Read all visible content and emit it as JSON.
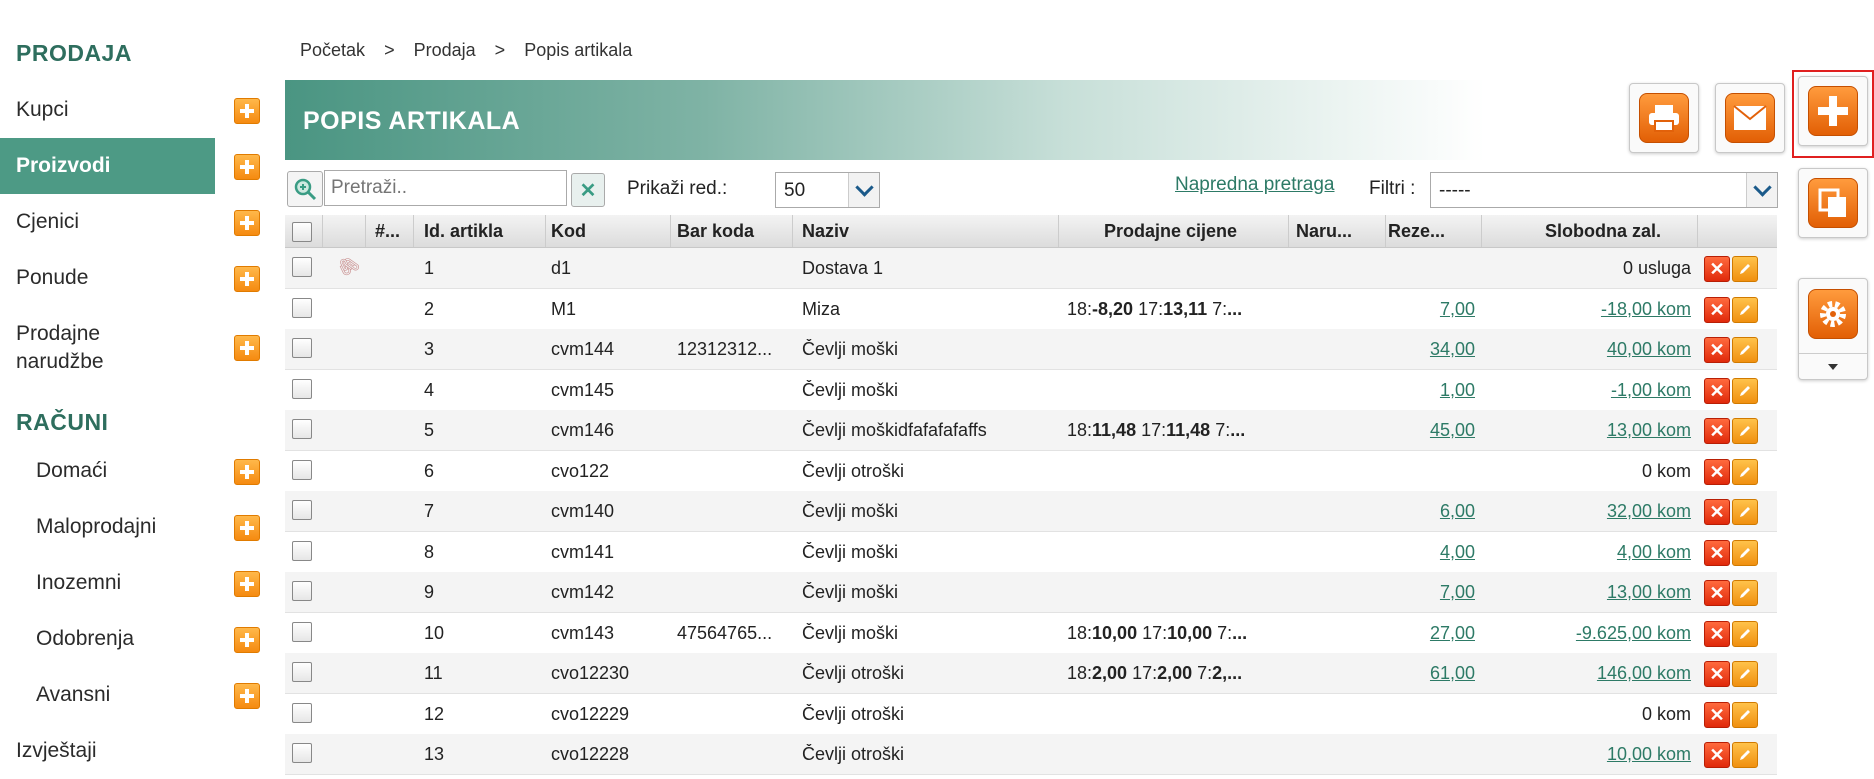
{
  "sidebar": {
    "section_sales": "PRODAJA",
    "items": [
      {
        "label": "Kupci"
      },
      {
        "label": "Proizvodi"
      },
      {
        "label": "Cjenici"
      },
      {
        "label": "Ponude"
      },
      {
        "label": "Prodajne narudžbe"
      }
    ],
    "section_invoices": "RAČUNI",
    "invoice_items": [
      {
        "label": "Domaći"
      },
      {
        "label": "Maloprodajni"
      },
      {
        "label": "Inozemni"
      },
      {
        "label": "Odobrenja"
      },
      {
        "label": "Avansni"
      }
    ],
    "reports": "Izvještaji"
  },
  "breadcrumb": {
    "home": "Početak",
    "sales": "Prodaja",
    "current": "Popis artikala",
    "separator": ">"
  },
  "page_title": "POPIS ARTIKALA",
  "toolbar": {
    "search_placeholder": "Pretraži..",
    "show_rows_label": "Prikaži red.:",
    "rows_value": "50",
    "advanced_search": "Napredna pretraga",
    "filters_label": "Filtri :",
    "filter_value": "-----"
  },
  "table": {
    "headers": {
      "num": "#...",
      "id": "Id. artikla",
      "code": "Kod",
      "barcode": "Bar koda",
      "name": "Naziv",
      "prices": "Prodajne cijene",
      "ordered": "Naru...",
      "reserved": "Reze...",
      "stock": "Slobodna zal."
    },
    "rows": [
      {
        "id": "1",
        "code": "d1",
        "barcode": "",
        "name": "Dostava 1",
        "prices": "",
        "reserved": "",
        "stock": "0 usluga",
        "stock_link": false,
        "attachment": true
      },
      {
        "id": "2",
        "code": "M1",
        "barcode": "",
        "name": "Miza",
        "prices": "18:-8,20 17:13,11 7:...",
        "reserved": "7,00",
        "stock": "-18,00 kom",
        "stock_link": true
      },
      {
        "id": "3",
        "code": "cvm144",
        "barcode": "12312312...",
        "name": "Čevlji moški",
        "prices": "",
        "reserved": "34,00",
        "stock": "40,00 kom",
        "stock_link": true
      },
      {
        "id": "4",
        "code": "cvm145",
        "barcode": "",
        "name": "Čevlji moški",
        "prices": "",
        "reserved": "1,00",
        "stock": "-1,00 kom",
        "stock_link": true
      },
      {
        "id": "5",
        "code": "cvm146",
        "barcode": "",
        "name": "Čevlji moškidfafafafaffs",
        "prices": "18:11,48 17:11,48 7:...",
        "reserved": "45,00",
        "stock": "13,00 kom",
        "stock_link": true
      },
      {
        "id": "6",
        "code": "cvo122",
        "barcode": "",
        "name": "Čevlji otroški",
        "prices": "",
        "reserved": "",
        "stock": "0 kom",
        "stock_link": false
      },
      {
        "id": "7",
        "code": "cvm140",
        "barcode": "",
        "name": "Čevlji moški",
        "prices": "",
        "reserved": "6,00",
        "stock": "32,00 kom",
        "stock_link": true
      },
      {
        "id": "8",
        "code": "cvm141",
        "barcode": "",
        "name": "Čevlji moški",
        "prices": "",
        "reserved": "4,00",
        "stock": "4,00 kom",
        "stock_link": true
      },
      {
        "id": "9",
        "code": "cvm142",
        "barcode": "",
        "name": "Čevlji moški",
        "prices": "",
        "reserved": "7,00",
        "stock": "13,00 kom",
        "stock_link": true
      },
      {
        "id": "10",
        "code": "cvm143",
        "barcode": "47564765...",
        "name": "Čevlji moški",
        "prices": "18:10,00 17:10,00 7:...",
        "reserved": "27,00",
        "stock": "-9.625,00 kom",
        "stock_link": true
      },
      {
        "id": "11",
        "code": "cvo12230",
        "barcode": "",
        "name": "Čevlji otroški",
        "prices": "18:2,00 17:2,00 7:2,...",
        "reserved": "61,00",
        "stock": "146,00 kom",
        "stock_link": true
      },
      {
        "id": "12",
        "code": "cvo12229",
        "barcode": "",
        "name": "Čevlji otroški",
        "prices": "",
        "reserved": "",
        "stock": "0 kom",
        "stock_link": false
      },
      {
        "id": "13",
        "code": "cvo12228",
        "barcode": "",
        "name": "Čevlji otroški",
        "prices": "",
        "reserved": "",
        "stock": "10,00 kom",
        "stock_link": true
      }
    ]
  },
  "colors": {
    "accent": "#4d9a85",
    "link": "#2d7a66",
    "orange": "#f58a10",
    "highlight": "#e02020"
  },
  "icons": [
    "zoom-icon",
    "clear-icon",
    "print-icon",
    "mail-icon",
    "add-icon",
    "copy-icon",
    "settings-icon",
    "delete-icon",
    "edit-icon",
    "attachment-icon"
  ]
}
